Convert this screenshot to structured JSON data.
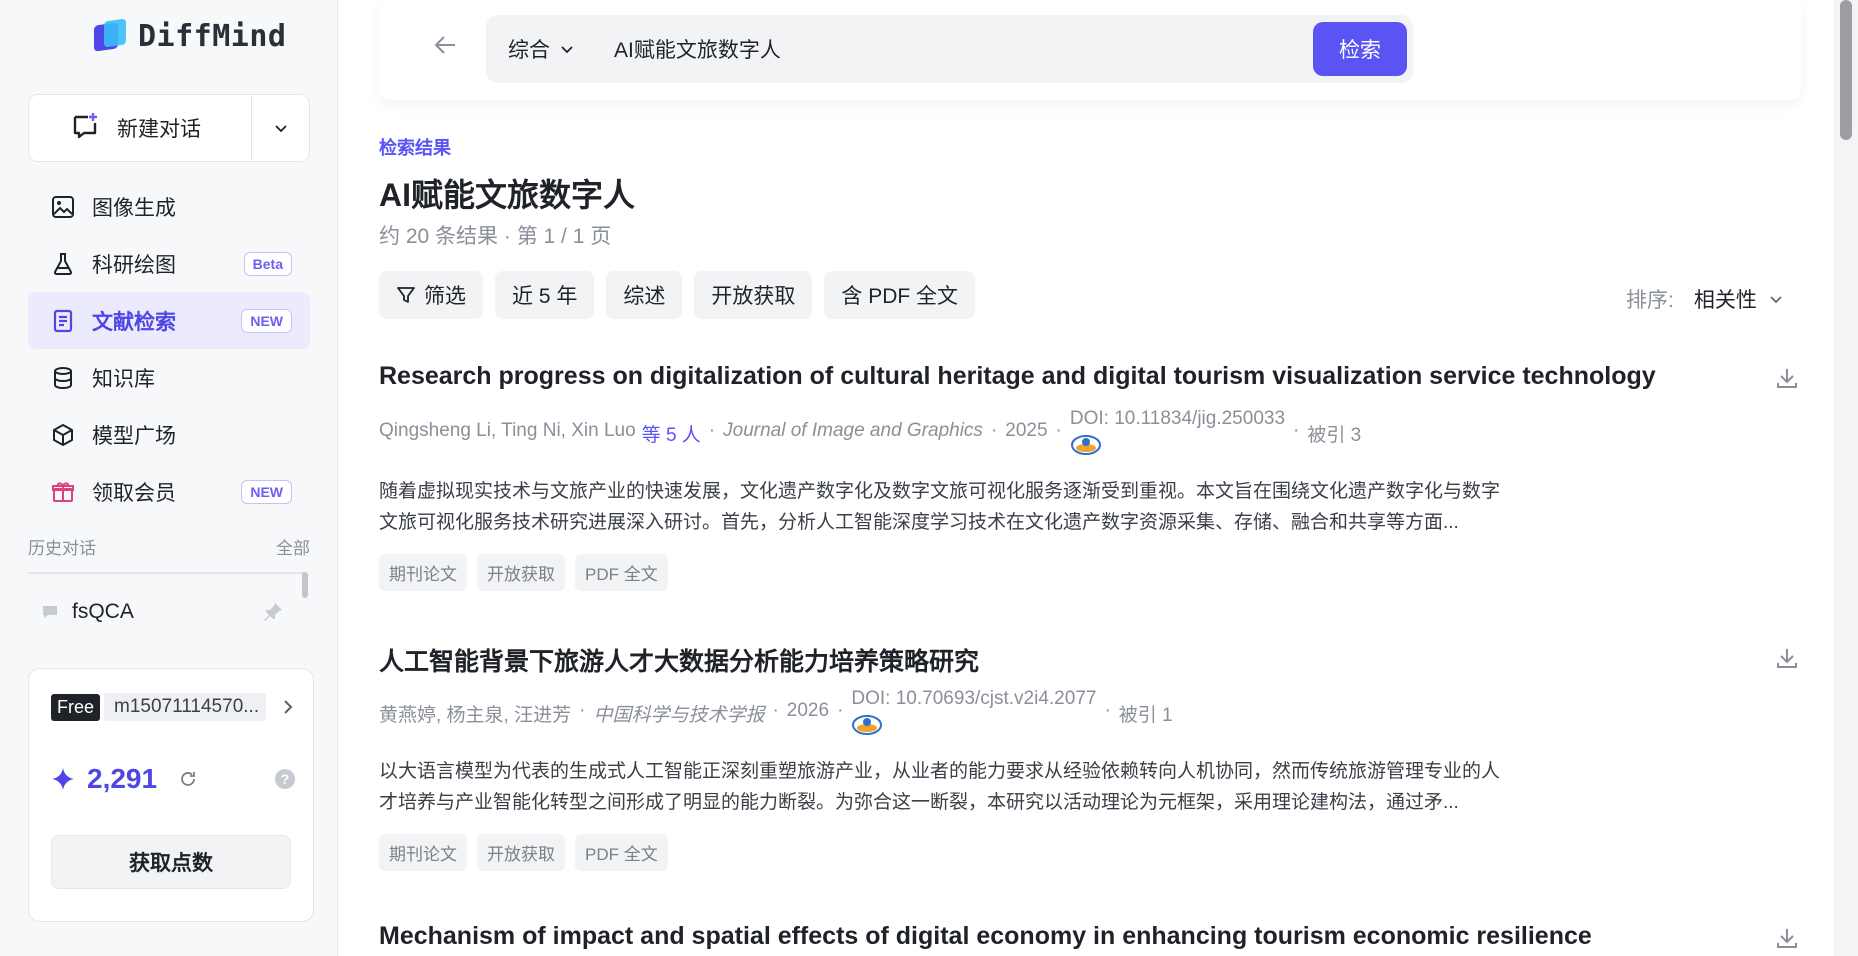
{
  "app": {
    "logo_text": "DiffMind"
  },
  "sidebar": {
    "new_chat_label": "新建对话",
    "items": [
      {
        "label": "图像生成",
        "icon": "image-icon",
        "badge": ""
      },
      {
        "label": "科研绘图",
        "icon": "flask-icon",
        "badge": "Beta"
      },
      {
        "label": "文献检索",
        "icon": "document-icon",
        "badge": "NEW",
        "active": true
      },
      {
        "label": "知识库",
        "icon": "database-icon",
        "badge": ""
      },
      {
        "label": "模型广场",
        "icon": "cube-icon",
        "badge": ""
      },
      {
        "label": "领取会员",
        "icon": "gift-icon",
        "badge": "NEW"
      }
    ],
    "history": {
      "title": "历史对话",
      "all_label": "全部",
      "items": [
        {
          "label": "fsQCA"
        }
      ]
    },
    "account": {
      "plan": "Free",
      "user_id": "m15071114570...",
      "points": "2,291",
      "get_points_label": "获取点数",
      "help_label": "?"
    }
  },
  "search": {
    "scope": "综合",
    "query": "AI赋能文旅数字人",
    "button_label": "检索"
  },
  "results": {
    "section_label": "检索结果",
    "title": "AI赋能文旅数字人",
    "count_text": "约 20 条结果 · 第 1 / 1 页",
    "filters": [
      {
        "label": "筛选",
        "icon": "filter-icon"
      },
      {
        "label": "近 5 年"
      },
      {
        "label": "综述"
      },
      {
        "label": "开放获取"
      },
      {
        "label": "含 PDF 全文",
        "icon": ""
      }
    ],
    "sort_label": "排序:",
    "sort_value": "相关性",
    "papers": [
      {
        "title": "Research progress on digitalization of cultural heritage and digital tourism visualization service technology",
        "authors": "Qingsheng Li, Ting Ni, Xin Luo",
        "more_authors": "等 5 人",
        "journal": "Journal of Image and Graphics",
        "year": "2025",
        "doi": "DOI: 10.11834/jig.250033",
        "citations": "被引 3",
        "abstract": "随着虚拟现实技术与文旅产业的快速发展，文化遗产数字化及数字文旅可视化服务逐渐受到重视。本文旨在围绕文化遗产数字化与数字文旅可视化服务技术研究进展深入研讨。首先，分析人工智能深度学习技术在文化遗产数字资源采集、存储、融合和共享等方面...",
        "tags": [
          "期刊论文",
          "开放获取",
          "PDF 全文"
        ]
      },
      {
        "title": "人工智能背景下旅游人才大数据分析能力培养策略研究",
        "authors": "黄燕婷, 杨主泉, 汪进芳",
        "more_authors": "",
        "journal": "中国科学与技术学报",
        "year": "2026",
        "doi": "DOI: 10.70693/cjst.v2i4.2077",
        "citations": "被引 1",
        "abstract": "以大语言模型为代表的生成式人工智能正深刻重塑旅游产业，从业者的能力要求从经验依赖转向人机协同，然而传统旅游管理专业的人才培养与产业智能化转型之间形成了明显的能力断裂。为弥合这一断裂，本研究以活动理论为元框架，采用理论建构法，通过矛...",
        "tags": [
          "期刊论文",
          "开放获取",
          "PDF 全文"
        ]
      },
      {
        "title": "Mechanism of impact and spatial effects of digital economy in enhancing tourism economic resilience"
      }
    ]
  }
}
